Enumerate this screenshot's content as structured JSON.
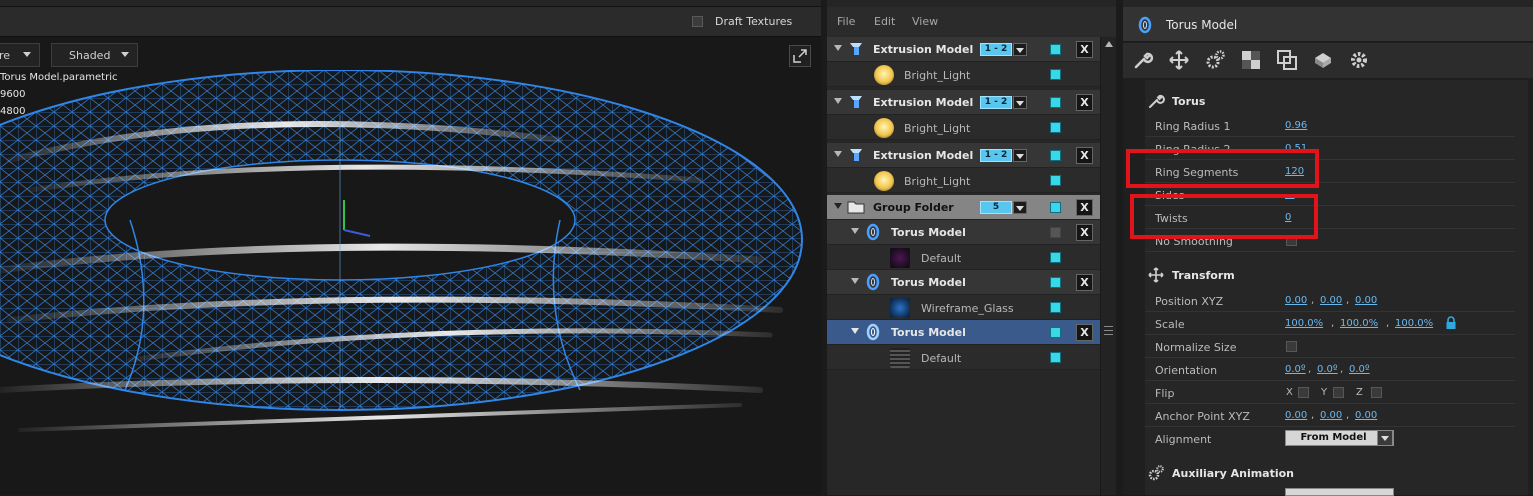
{
  "viewport": {
    "draft_textures_label": "Draft Textures",
    "view_mode_label": "re",
    "shade_mode_label": "Shaded",
    "info_lines": [
      "Torus Model.parametric",
      "9600",
      "4800"
    ]
  },
  "layer_panel": {
    "menu": [
      "File",
      "Edit",
      "View"
    ],
    "rows": [
      {
        "kind": "model",
        "name": "Extrusion Model",
        "icon": "extrusion-icon",
        "range": "1 - 2",
        "visible": true
      },
      {
        "kind": "sub",
        "name": "Bright_Light",
        "icon": "light-material-icon",
        "visible": true
      },
      {
        "kind": "model",
        "name": "Extrusion Model",
        "icon": "extrusion-icon",
        "range": "1 - 2",
        "visible": true
      },
      {
        "kind": "sub",
        "name": "Bright_Light",
        "icon": "light-material-icon",
        "visible": true
      },
      {
        "kind": "model",
        "name": "Extrusion Model",
        "icon": "extrusion-icon",
        "range": "1 - 2",
        "visible": true
      },
      {
        "kind": "sub",
        "name": "Bright_Light",
        "icon": "light-material-icon",
        "visible": true
      },
      {
        "kind": "group",
        "name": "Group Folder",
        "icon": "folder-icon",
        "range": "5",
        "visible": true
      },
      {
        "kind": "model",
        "name": "Torus Model",
        "icon": "torus-icon",
        "visible": false
      },
      {
        "kind": "sub",
        "name": "Default",
        "icon": "default-material-icon",
        "visible": true
      },
      {
        "kind": "model",
        "name": "Torus Model",
        "icon": "torus-icon",
        "visible": true
      },
      {
        "kind": "sub",
        "name": "Wireframe_Glass",
        "icon": "wireframe-material-icon",
        "visible": true
      },
      {
        "kind": "model",
        "name": "Torus Model",
        "icon": "torus-icon",
        "visible": true,
        "selected": true
      },
      {
        "kind": "sub",
        "name": "Default",
        "icon": "default-material-icon",
        "visible": true
      }
    ]
  },
  "properties": {
    "title": "Torus Model",
    "toolbar_icons": [
      "wrench-icon",
      "move-icon",
      "gears-icon",
      "checker-icon",
      "layers-icon",
      "cube-icon",
      "gear-icon"
    ],
    "torus": {
      "title": "Torus",
      "ring_radius_1": {
        "label": "Ring Radius 1",
        "value": "0.96"
      },
      "ring_radius_2": {
        "label": "Ring Radius 2",
        "value": "0.51"
      },
      "ring_segments": {
        "label": "Ring Segments",
        "value": "120"
      },
      "sides": {
        "label": "Sides",
        "value": "..."
      },
      "twists": {
        "label": "Twists",
        "value": "0"
      },
      "no_smoothing": {
        "label": "No Smoothing"
      }
    },
    "transform": {
      "title": "Transform",
      "position": {
        "label": "Position XYZ",
        "values": [
          "0.00",
          "0.00",
          "0.00"
        ]
      },
      "scale": {
        "label": "Scale",
        "values": [
          "100.0%",
          "100.0%",
          "100.0%"
        ]
      },
      "normalize": {
        "label": "Normalize Size"
      },
      "orientation": {
        "label": "Orientation",
        "values": [
          "0.0º",
          "0.0º",
          "0.0º"
        ]
      },
      "flip": {
        "label": "Flip",
        "axes": [
          "X",
          "Y",
          "Z"
        ]
      },
      "anchor": {
        "label": "Anchor Point XYZ",
        "values": [
          "0.00",
          "0.00",
          "0.00"
        ]
      },
      "alignment": {
        "label": "Alignment",
        "value": "From Model"
      }
    },
    "aux": {
      "title": "Auxiliary Animation"
    }
  },
  "colors": {
    "accent": "#58c6ee",
    "selection": "#3a5a8c",
    "highlight": "#e2131b",
    "link": "#69b9ef"
  }
}
